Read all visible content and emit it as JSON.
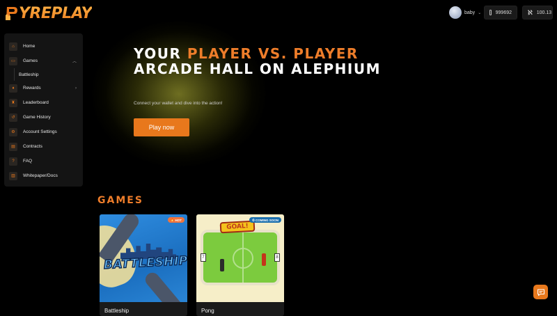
{
  "brand": {
    "logo_text": "YREPLAY",
    "accent_color": "#e8781c"
  },
  "header": {
    "username": "baby",
    "balance_primary": "999692",
    "balance_secondary": "100.13"
  },
  "sidebar": {
    "items": [
      {
        "label": "Home",
        "icon": "home-icon"
      },
      {
        "label": "Games",
        "icon": "gamepad-icon",
        "expanded": true
      },
      {
        "label": "Battleship",
        "sub": true
      },
      {
        "label": "Rewards",
        "icon": "gift-icon"
      },
      {
        "label": "Leaderboard",
        "icon": "trophy-icon"
      },
      {
        "label": "Game History",
        "icon": "history-icon"
      },
      {
        "label": "Account Settings",
        "icon": "gear-icon"
      },
      {
        "label": "Contracts",
        "icon": "document-icon"
      },
      {
        "label": "FAQ",
        "icon": "question-icon"
      },
      {
        "label": "Whitepaper/Docs",
        "icon": "book-icon"
      }
    ]
  },
  "hero": {
    "title_part1": "Your ",
    "title_accent": "Player vs. Player",
    "title_part2": "Arcade Hall on Alephium",
    "subtitle": "Connect your wallet and dive into the action!",
    "cta_label": "Play now"
  },
  "games": {
    "heading": "GAMES",
    "cards": [
      {
        "name": "Battleship",
        "tag": "HOT",
        "art_title": "BATTLESHIP"
      },
      {
        "name": "Pong",
        "tag": "COMING SOON",
        "art_title": "GOAL!"
      }
    ]
  }
}
